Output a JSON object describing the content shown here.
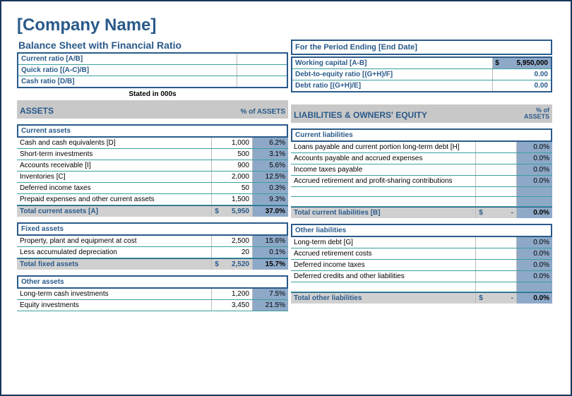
{
  "company_name": "[Company Name]",
  "subtitle": "Balance Sheet with Financial Ratio",
  "period_header": "For the Period Ending [End Date]",
  "left_ratios": [
    {
      "label": "Current ratio  [A/B]",
      "value": ""
    },
    {
      "label": "Quick ratio  [(A-C)/B]",
      "value": ""
    },
    {
      "label": "Cash ratio  [D/B]",
      "value": ""
    }
  ],
  "right_ratios": [
    {
      "label": "Working capital  [A-B]",
      "currency": "$",
      "value": "5,950,000",
      "highlight": true
    },
    {
      "label": "Debt-to-equity ratio  [(G+H)/F]",
      "currency": "",
      "value": "0.00",
      "highlight": false
    },
    {
      "label": "Debt ratio  [(G+H)/E]",
      "currency": "",
      "value": "0.00",
      "highlight": false
    }
  ],
  "stated_in": "Stated in 000s",
  "assets_header": "ASSETS",
  "pct_assets_label": "% of ASSETS",
  "liab_header": "LIABILITIES & OWNERS' EQUITY",
  "current_assets": {
    "title": "Current assets",
    "rows": [
      {
        "label": "Cash and cash equivalents  [D]",
        "value": "1,000",
        "pct": "6.2%"
      },
      {
        "label": "Short-term investments",
        "value": "500",
        "pct": "3.1%"
      },
      {
        "label": "Accounts receivable  [I]",
        "value": "900",
        "pct": "5.6%"
      },
      {
        "label": "Inventories  [C]",
        "value": "2,000",
        "pct": "12.5%"
      },
      {
        "label": "Deferred income taxes",
        "value": "50",
        "pct": "0.3%"
      },
      {
        "label": "Prepaid expenses and other current assets",
        "value": "1,500",
        "pct": "9.3%"
      }
    ],
    "total": {
      "label": "Total current assets  [A]",
      "currency": "$",
      "value": "5,950",
      "pct": "37.0%"
    }
  },
  "fixed_assets": {
    "title": "Fixed assets",
    "rows": [
      {
        "label": "Property, plant and equipment at cost",
        "value": "2,500",
        "pct": "15.6%"
      },
      {
        "label": "Less accumulated depreciation",
        "value": "20",
        "pct": "0.1%"
      }
    ],
    "total": {
      "label": "Total fixed assets",
      "currency": "$",
      "value": "2,520",
      "pct": "15.7%"
    }
  },
  "other_assets": {
    "title": "Other assets",
    "rows": [
      {
        "label": "Long-term cash investments",
        "value": "1,200",
        "pct": "7.5%"
      },
      {
        "label": "Equity investments",
        "value": "3,450",
        "pct": "21.5%"
      }
    ]
  },
  "current_liab": {
    "title": "Current liabilities",
    "rows": [
      {
        "label": "Loans payable and current portion long-term debt  [H]",
        "value": "",
        "pct": "0.0%"
      },
      {
        "label": "Accounts payable and accrued expenses",
        "value": "",
        "pct": "0.0%"
      },
      {
        "label": "Income taxes payable",
        "value": "",
        "pct": "0.0%"
      },
      {
        "label": "Accrued retirement and profit-sharing contributions",
        "value": "",
        "pct": "0.0%"
      }
    ],
    "total": {
      "label": "Total current liabilities  [B]",
      "currency": "$",
      "value": "-",
      "pct": "0.0%"
    }
  },
  "other_liab": {
    "title": "Other liabilities",
    "rows": [
      {
        "label": "Long-term debt  [G]",
        "value": "",
        "pct": "0.0%"
      },
      {
        "label": "Accrued retirement costs",
        "value": "",
        "pct": "0.0%"
      },
      {
        "label": "Deferred income taxes",
        "value": "",
        "pct": "0.0%"
      },
      {
        "label": "Deferred credits and other liabilities",
        "value": "",
        "pct": "0.0%"
      }
    ],
    "total": {
      "label": "Total other liabilities",
      "currency": "$",
      "value": "-",
      "pct": "0.0%"
    }
  }
}
